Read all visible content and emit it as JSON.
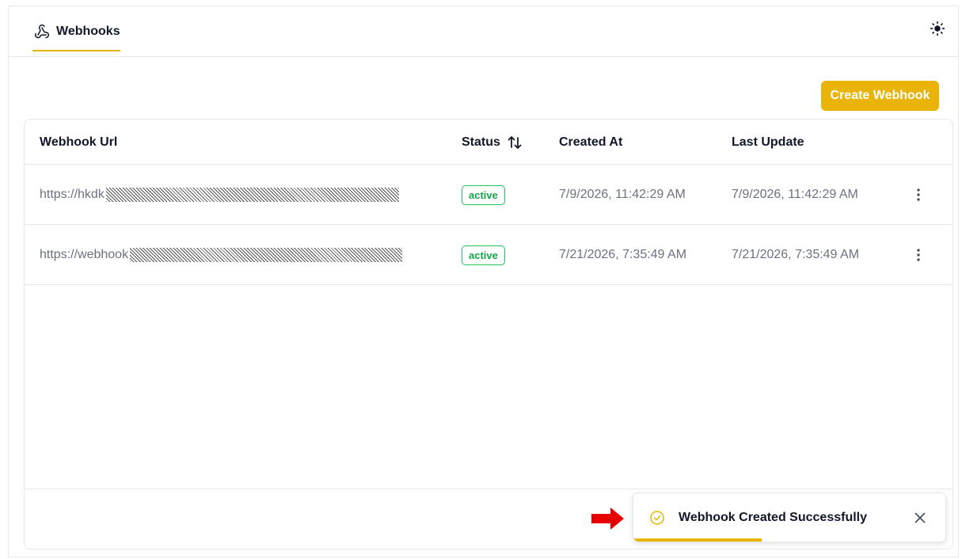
{
  "header": {
    "tab_label": "Webhooks",
    "tab_icon": "webhook-icon",
    "theme_icon": "sun-icon"
  },
  "toolbar": {
    "create_label": "Create Webhook",
    "accent_color": "#eab308"
  },
  "table": {
    "columns": [
      "Webhook Url",
      "Status",
      "Created At",
      "Last Update"
    ],
    "sort_icon": "sort-arrows-icon",
    "rows": [
      {
        "url": "https://hkdk",
        "status": "active",
        "created_at": "7/9/2026, 11:42:29 AM",
        "last_update": "7/9/2026, 11:42:29 AM"
      },
      {
        "url": "https://webhook",
        "status": "active",
        "created_at": "7/21/2026, 7:35:49 AM",
        "last_update": "7/21/2026, 7:35:49 AM"
      }
    ]
  },
  "toast": {
    "message": "Webhook Created Successfully",
    "icon": "check-circle-icon",
    "progress": 0.41,
    "color": "#eab308"
  },
  "annotation": {
    "arrow_color": "#e60000"
  }
}
